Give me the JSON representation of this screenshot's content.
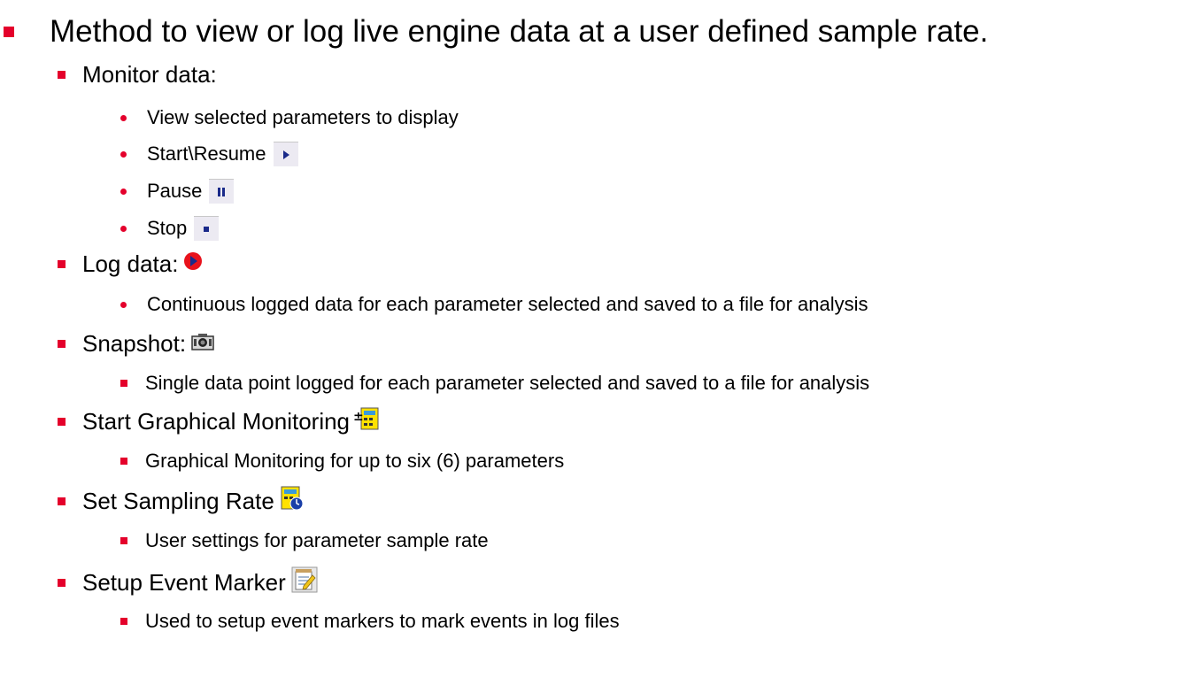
{
  "intro": "Method to view or log live engine data at a user defined sample rate.",
  "monitor": {
    "heading": "Monitor data:",
    "items": [
      "View selected parameters to display",
      "Start\\Resume",
      "Pause",
      "Stop"
    ]
  },
  "log": {
    "heading": "Log data:",
    "detail": "Continuous logged data for each parameter selected and saved to a file for analysis"
  },
  "snapshot": {
    "heading": "Snapshot:",
    "detail": "Single data point logged for each parameter selected and saved to a file for analysis"
  },
  "graphical": {
    "heading": "Start Graphical Monitoring",
    "detail": "Graphical Monitoring for up to six (6) parameters"
  },
  "sampling": {
    "heading": "Set Sampling Rate",
    "detail": "User settings for parameter sample rate"
  },
  "event": {
    "heading": "Setup Event Marker",
    "detail": "Used to setup event markers to mark events in log files"
  },
  "colors": {
    "bullet": "#e4002b",
    "icon_navy": "#1a2a8a"
  }
}
